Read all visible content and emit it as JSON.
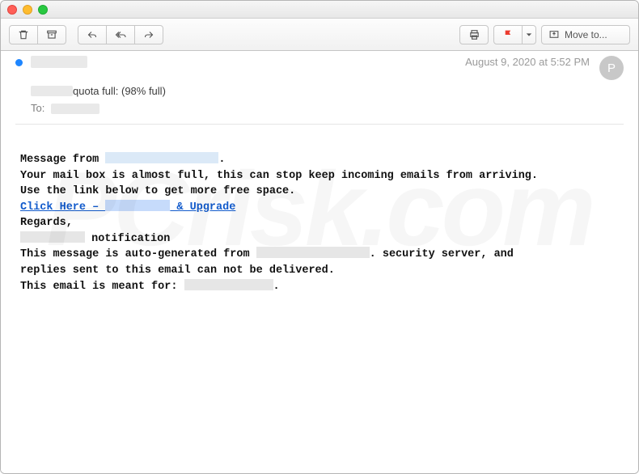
{
  "window": {
    "datetime": "August 9, 2020 at 5:52 PM",
    "avatar_initial": "P",
    "subject_part1": "",
    "subject_part2": " quota full: (98% full)",
    "to_label": "To:",
    "move_to_label": "Move to..."
  },
  "toolbar": {
    "delete": "delete",
    "archive": "archive",
    "reply": "reply",
    "reply_all": "reply-all",
    "forward": "forward",
    "print": "print",
    "flag": "flag",
    "move": "move"
  },
  "body": {
    "msg_from_prefix": "Message from ",
    "msg_from_suffix": ".",
    "warn_line1": "Your mail box is almost full, this can stop keep incoming emails from arriving.",
    "warn_line2": "Use the link below to get more free space.",
    "link_part1": "Click Here – ",
    "link_part2": " & Upgrade",
    "regards": "Regards,",
    "notification_suffix": " notification",
    "auto1_prefix": "This message is auto-generated from ",
    "auto1_suffix": ". security server, and",
    "auto2": "replies sent to this email can not be delivered.",
    "meant_prefix": "This email is meant for: ",
    "meant_suffix": "."
  },
  "watermark": "PCrisk.com"
}
